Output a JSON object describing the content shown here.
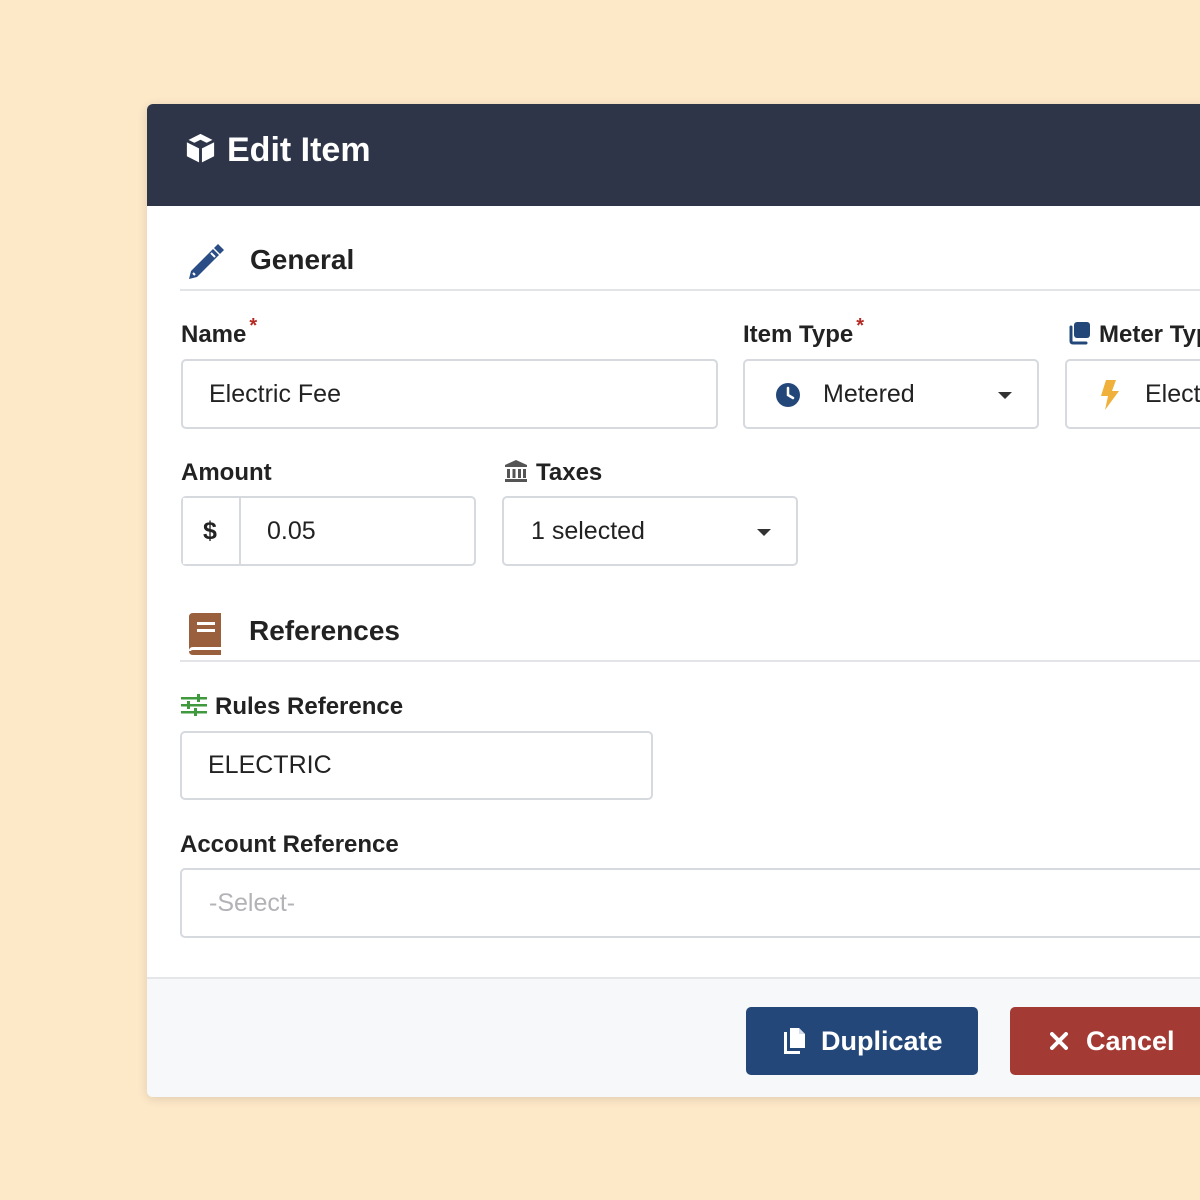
{
  "modal": {
    "title": "Edit Item",
    "title_icon": "cube-icon"
  },
  "sections": {
    "general": {
      "title": "General",
      "icon": "pencil-icon"
    },
    "references": {
      "title": "References",
      "icon": "book-icon"
    }
  },
  "fields": {
    "name": {
      "label": "Name",
      "required_mark": "*",
      "value": "Electric Fee"
    },
    "item_type": {
      "label": "Item Type",
      "required_mark": "*",
      "value": "Metered",
      "value_icon": "clock-icon"
    },
    "meter_type": {
      "label": "Meter Typ",
      "label_icon": "layers-icon",
      "value": "Elect",
      "value_icon": "bolt-icon"
    },
    "amount": {
      "label": "Amount",
      "prefix": "$",
      "value": "0.05"
    },
    "taxes": {
      "label": "Taxes",
      "label_icon": "bank-icon",
      "value": "1 selected"
    },
    "rules_reference": {
      "label": "Rules Reference",
      "label_icon": "sliders-icon",
      "value": "ELECTRIC"
    },
    "account_reference": {
      "label": "Account Reference",
      "placeholder": "-Select-"
    }
  },
  "footer": {
    "duplicate_label": "Duplicate",
    "duplicate_icon": "copy-icon",
    "cancel_label": "Cancel",
    "cancel_icon": "close-icon"
  },
  "colors": {
    "page_background": "#fde8c8",
    "header_background": "#2e3549",
    "accent_blue": "#24477a",
    "danger_red": "#a33a33",
    "required_red": "#b52a24",
    "bolt_yellow": "#f0b13c",
    "book_brown": "#9a5f3c",
    "sliders_green": "#3f9a3e"
  }
}
